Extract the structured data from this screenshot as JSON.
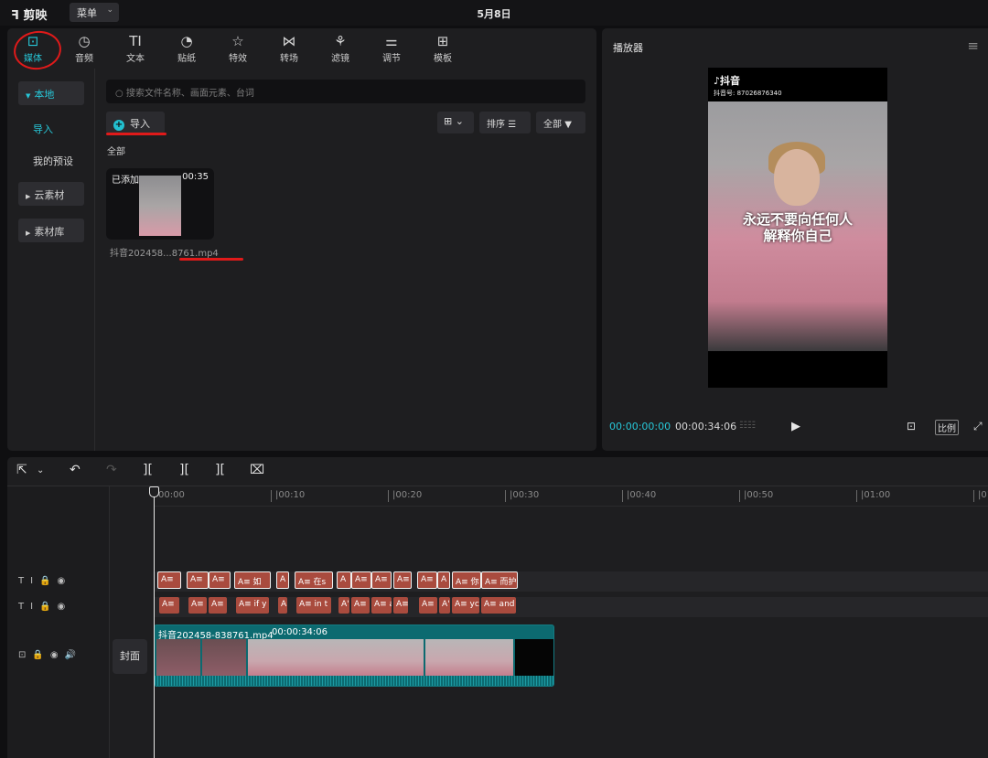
{
  "app": {
    "name": "剪映",
    "menu_label": "菜单",
    "date": "5月8日"
  },
  "tabs": [
    {
      "label": "媒体",
      "icon": "media-icon"
    },
    {
      "label": "音频",
      "icon": "audio-icon"
    },
    {
      "label": "文本",
      "icon": "text-icon"
    },
    {
      "label": "贴纸",
      "icon": "sticker-icon"
    },
    {
      "label": "特效",
      "icon": "effects-icon"
    },
    {
      "label": "转场",
      "icon": "transition-icon"
    },
    {
      "label": "滤镜",
      "icon": "filter-icon"
    },
    {
      "label": "调节",
      "icon": "adjust-icon"
    },
    {
      "label": "模板",
      "icon": "template-icon"
    }
  ],
  "sidebar": {
    "local": "本地",
    "import": "导入",
    "presets": "我的预设",
    "cloud": "云素材",
    "library": "素材库"
  },
  "media": {
    "search_placeholder": "搜索文件名称、画面元素、台词",
    "import_label": "导入",
    "sort_label": "排序",
    "all_filter_label": "全部",
    "section_label": "全部",
    "item": {
      "added_badge": "已添加",
      "duration": "00:35",
      "filename": "抖音202458...8761.mp4"
    }
  },
  "player": {
    "title": "播放器",
    "brand": "抖音",
    "account_id": "抖音号: 87026876340",
    "caption_line1": "永远不要向任何人",
    "caption_line2": "解释你自己",
    "current_time": "00:00:00:00",
    "total_time": "00:00:34:06",
    "ratio_label": "比例"
  },
  "timeline": {
    "ruler": [
      "00:00",
      "|00:10",
      "|00:20",
      "|00:30",
      "|00:40",
      "|00:50",
      "|01:00",
      "|01:"
    ],
    "cover_label": "封面",
    "video_clip": {
      "name": "抖音202458-838761.mp4",
      "duration": "00:00:34:06"
    },
    "text_track_1": [
      "A≡",
      "A≡",
      "A≡",
      "A≡ 如",
      "A",
      "A≡ 在s",
      "A",
      "A≡",
      "A≡",
      "A≡",
      "A≡",
      "A",
      "A≡ 你",
      "A≡ 而护"
    ],
    "text_track_2": [
      "A≡",
      "A≡",
      "A≡",
      "A≡ if y",
      "A",
      "A≡ in t",
      "A'",
      "A≡",
      "A≡ a",
      "A≡",
      "A≡",
      "A'",
      "A≡ yc",
      "A≡ and"
    ]
  },
  "colors": {
    "accent": "#27c7d8",
    "annotation_red": "#e01a1a",
    "text_clip": "#a94b3e",
    "video_clip": "#0c6a70"
  }
}
